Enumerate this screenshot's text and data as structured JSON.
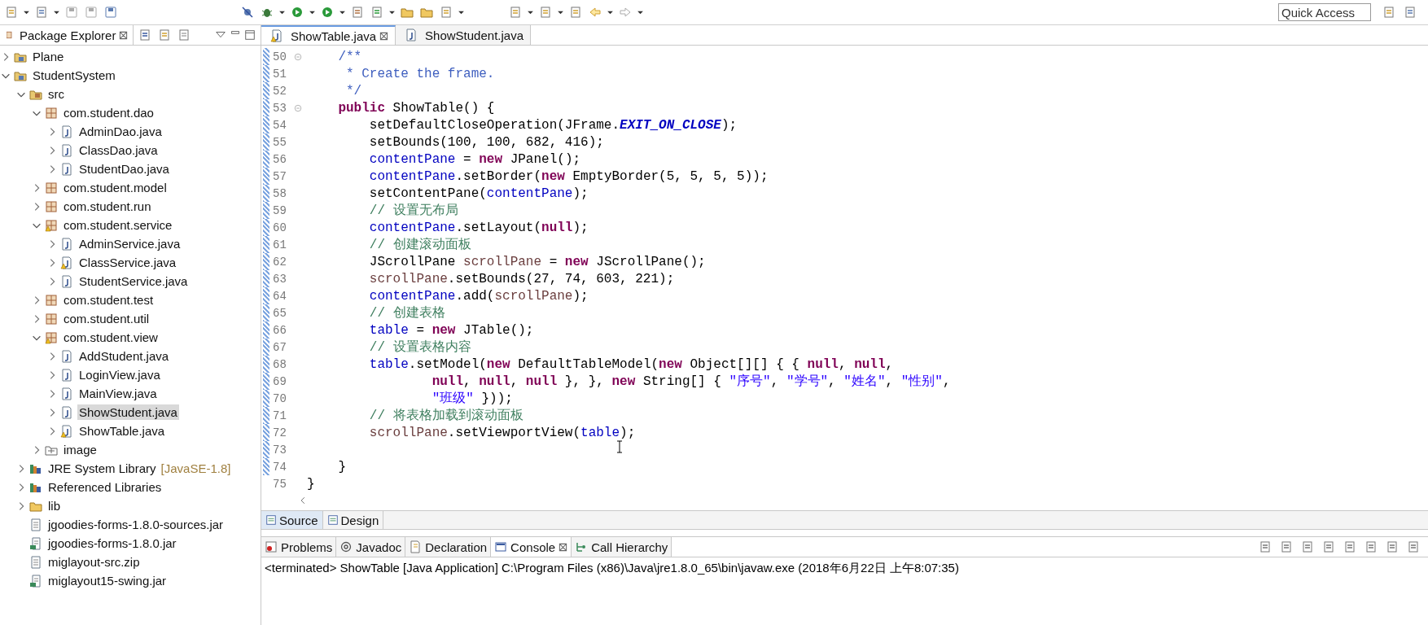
{
  "toolbar": {
    "quick_access": {
      "placeholder": "Quick Access"
    }
  },
  "package_explorer": {
    "title": "Package Explorer",
    "tree": [
      {
        "label": "Plane",
        "kind": "project",
        "expanded": false
      },
      {
        "label": "StudentSystem",
        "kind": "project",
        "expanded": true,
        "children": [
          {
            "label": "src",
            "kind": "source-folder",
            "expanded": true,
            "children": [
              {
                "label": "com.student.dao",
                "kind": "package",
                "expanded": true,
                "children": [
                  {
                    "label": "AdminDao.java",
                    "kind": "java",
                    "expanded": false,
                    "selected": false
                  },
                  {
                    "label": "ClassDao.java",
                    "kind": "java",
                    "expanded": false,
                    "selected": false
                  },
                  {
                    "label": "StudentDao.java",
                    "kind": "java",
                    "expanded": false,
                    "selected": false
                  }
                ]
              },
              {
                "label": "com.student.model",
                "kind": "package",
                "expanded": false
              },
              {
                "label": "com.student.run",
                "kind": "package",
                "expanded": false
              },
              {
                "label": "com.student.service",
                "kind": "package",
                "expanded": true,
                "warning": true,
                "children": [
                  {
                    "label": "AdminService.java",
                    "kind": "java",
                    "expanded": false,
                    "selected": false
                  },
                  {
                    "label": "ClassService.java",
                    "kind": "java",
                    "expanded": false,
                    "warning": true,
                    "selected": false
                  },
                  {
                    "label": "StudentService.java",
                    "kind": "java",
                    "expanded": false,
                    "selected": false
                  }
                ]
              },
              {
                "label": "com.student.test",
                "kind": "package",
                "expanded": false
              },
              {
                "label": "com.student.util",
                "kind": "package",
                "expanded": false
              },
              {
                "label": "com.student.view",
                "kind": "package",
                "expanded": true,
                "warning": true,
                "children": [
                  {
                    "label": "AddStudent.java",
                    "kind": "java",
                    "expanded": false,
                    "selected": false
                  },
                  {
                    "label": "LoginView.java",
                    "kind": "java",
                    "expanded": false,
                    "selected": false
                  },
                  {
                    "label": "MainView.java",
                    "kind": "java",
                    "expanded": false,
                    "selected": false
                  },
                  {
                    "label": "ShowStudent.java",
                    "kind": "java",
                    "expanded": false,
                    "selected": true
                  },
                  {
                    "label": "ShowTable.java",
                    "kind": "java",
                    "expanded": false,
                    "warning": true,
                    "selected": false
                  }
                ]
              },
              {
                "label": "image",
                "kind": "image-folder",
                "expanded": false
              }
            ]
          },
          {
            "label": "JRE System Library",
            "suffix": "[JavaSE-1.8]",
            "kind": "library",
            "expanded": false
          },
          {
            "label": "Referenced Libraries",
            "kind": "library",
            "expanded": false
          },
          {
            "label": "lib",
            "kind": "folder",
            "expanded": false
          },
          {
            "label": "jgoodies-forms-1.8.0-sources.jar",
            "kind": "file"
          },
          {
            "label": "jgoodies-forms-1.8.0.jar",
            "kind": "jar"
          },
          {
            "label": "miglayout-src.zip",
            "kind": "file"
          },
          {
            "label": "miglayout15-swing.jar",
            "kind": "jar"
          }
        ]
      }
    ]
  },
  "editor": {
    "tabs": [
      {
        "label": "ShowTable.java",
        "selected": true,
        "warning": true
      },
      {
        "label": "ShowStudent.java",
        "selected": false,
        "warning": false
      }
    ],
    "lines": [
      {
        "number": "50",
        "fold": true,
        "tokens": [
          {
            "kind": "doc",
            "t": "    /**"
          }
        ]
      },
      {
        "number": "51",
        "tokens": [
          {
            "kind": "doc",
            "t": "     * Create the frame."
          }
        ]
      },
      {
        "number": "52",
        "tokens": [
          {
            "kind": "doc",
            "t": "     */"
          }
        ]
      },
      {
        "number": "53",
        "fold": true,
        "tokens": [
          {
            "kind": "kw",
            "t": "    public"
          },
          {
            "kind": "p",
            "t": " ShowTable() {"
          }
        ]
      },
      {
        "number": "54",
        "tokens": [
          {
            "kind": "p",
            "t": "        setDefaultCloseOperation(JFrame."
          },
          {
            "kind": "const",
            "t": "EXIT_ON_CLOSE"
          },
          {
            "kind": "p",
            "t": ");"
          }
        ]
      },
      {
        "number": "55",
        "tokens": [
          {
            "kind": "p",
            "t": "        setBounds(100, 100, 682, 416);"
          }
        ]
      },
      {
        "number": "56",
        "tokens": [
          {
            "kind": "fld",
            "t": "        contentPane"
          },
          {
            "kind": "p",
            "t": " = "
          },
          {
            "kind": "kw",
            "t": "new"
          },
          {
            "kind": "p",
            "t": " JPanel();"
          }
        ]
      },
      {
        "number": "57",
        "tokens": [
          {
            "kind": "fld",
            "t": "        contentPane"
          },
          {
            "kind": "p",
            "t": ".setBorder("
          },
          {
            "kind": "kw",
            "t": "new"
          },
          {
            "kind": "p",
            "t": " EmptyBorder(5, 5, 5, 5));"
          }
        ]
      },
      {
        "number": "58",
        "tokens": [
          {
            "kind": "p",
            "t": "        setContentPane("
          },
          {
            "kind": "fld",
            "t": "contentPane"
          },
          {
            "kind": "p",
            "t": ");"
          }
        ]
      },
      {
        "number": "59",
        "tokens": [
          {
            "kind": "cmt",
            "t": "        // 设置无布局"
          }
        ]
      },
      {
        "number": "60",
        "tokens": [
          {
            "kind": "fld",
            "t": "        contentPane"
          },
          {
            "kind": "p",
            "t": ".setLayout("
          },
          {
            "kind": "kw",
            "t": "null"
          },
          {
            "kind": "p",
            "t": ");"
          }
        ]
      },
      {
        "number": "61",
        "tokens": [
          {
            "kind": "cmt",
            "t": "        // 创建滚动面板"
          }
        ]
      },
      {
        "number": "62",
        "tokens": [
          {
            "kind": "p",
            "t": "        JScrollPane "
          },
          {
            "kind": "loc",
            "t": "scrollPane"
          },
          {
            "kind": "p",
            "t": " = "
          },
          {
            "kind": "kw",
            "t": "new"
          },
          {
            "kind": "p",
            "t": " JScrollPane();"
          }
        ]
      },
      {
        "number": "63",
        "tokens": [
          {
            "kind": "loc",
            "t": "        scrollPane"
          },
          {
            "kind": "p",
            "t": ".setBounds(27, 74, 603, 221);"
          }
        ]
      },
      {
        "number": "64",
        "tokens": [
          {
            "kind": "fld",
            "t": "        contentPane"
          },
          {
            "kind": "p",
            "t": ".add("
          },
          {
            "kind": "loc",
            "t": "scrollPane"
          },
          {
            "kind": "p",
            "t": ");"
          }
        ]
      },
      {
        "number": "65",
        "tokens": [
          {
            "kind": "cmt",
            "t": "        // 创建表格"
          }
        ]
      },
      {
        "number": "66",
        "tokens": [
          {
            "kind": "fld",
            "t": "        table"
          },
          {
            "kind": "p",
            "t": " = "
          },
          {
            "kind": "kw",
            "t": "new"
          },
          {
            "kind": "p",
            "t": " JTable();"
          }
        ]
      },
      {
        "number": "67",
        "tokens": [
          {
            "kind": "cmt",
            "t": "        // 设置表格内容"
          }
        ]
      },
      {
        "number": "68",
        "tokens": [
          {
            "kind": "fld",
            "t": "        table"
          },
          {
            "kind": "p",
            "t": ".setModel("
          },
          {
            "kind": "kw",
            "t": "new"
          },
          {
            "kind": "p",
            "t": " DefaultTableModel("
          },
          {
            "kind": "kw",
            "t": "new"
          },
          {
            "kind": "p",
            "t": " Object[][] { { "
          },
          {
            "kind": "kw",
            "t": "null"
          },
          {
            "kind": "p",
            "t": ", "
          },
          {
            "kind": "kw",
            "t": "null"
          },
          {
            "kind": "p",
            "t": ","
          }
        ]
      },
      {
        "number": "69",
        "tokens": [
          {
            "kind": "kw",
            "t": "                null"
          },
          {
            "kind": "p",
            "t": ", "
          },
          {
            "kind": "kw",
            "t": "null"
          },
          {
            "kind": "p",
            "t": ", "
          },
          {
            "kind": "kw",
            "t": "null"
          },
          {
            "kind": "p",
            "t": " }, }, "
          },
          {
            "kind": "kw",
            "t": "new"
          },
          {
            "kind": "p",
            "t": " String[] { "
          },
          {
            "kind": "str",
            "t": "\"序号\""
          },
          {
            "kind": "p",
            "t": ", "
          },
          {
            "kind": "str",
            "t": "\"学号\""
          },
          {
            "kind": "p",
            "t": ", "
          },
          {
            "kind": "str",
            "t": "\"姓名\""
          },
          {
            "kind": "p",
            "t": ", "
          },
          {
            "kind": "str",
            "t": "\"性别\""
          },
          {
            "kind": "p",
            "t": ","
          }
        ]
      },
      {
        "number": "70",
        "tokens": [
          {
            "kind": "str",
            "t": "                \"班级\""
          },
          {
            "kind": "p",
            "t": " }));"
          }
        ]
      },
      {
        "number": "71",
        "tokens": [
          {
            "kind": "cmt",
            "t": "        // 将表格加载到滚动面板"
          }
        ]
      },
      {
        "number": "72",
        "tokens": [
          {
            "kind": "loc",
            "t": "        scrollPane"
          },
          {
            "kind": "p",
            "t": ".setViewportView("
          },
          {
            "kind": "fld",
            "t": "table"
          },
          {
            "kind": "p",
            "t": ");"
          }
        ]
      },
      {
        "number": "73"
      },
      {
        "number": "74",
        "tokens": [
          {
            "kind": "p",
            "t": "    }"
          }
        ]
      },
      {
        "number": "75",
        "tokens": [
          {
            "kind": "p",
            "t": "}"
          }
        ]
      }
    ],
    "mode_tabs": [
      {
        "label": "Source",
        "selected": true
      },
      {
        "label": "Design",
        "selected": false
      }
    ]
  },
  "bottom_panel": {
    "tabs": [
      {
        "label": "Problems",
        "kind": "problems",
        "selected": false
      },
      {
        "label": "Javadoc",
        "kind": "javadoc",
        "selected": false
      },
      {
        "label": "Declaration",
        "kind": "declaration",
        "selected": false
      },
      {
        "label": "Console",
        "kind": "console",
        "selected": true
      },
      {
        "label": "Call Hierarchy",
        "kind": "hierarchy",
        "selected": false
      }
    ],
    "console_line": "<terminated> ShowTable [Java Application] C:\\Program Files (x86)\\Java\\jre1.8.0_65\\bin\\javaw.exe (2018年6月22日 上午8:07:35)"
  }
}
